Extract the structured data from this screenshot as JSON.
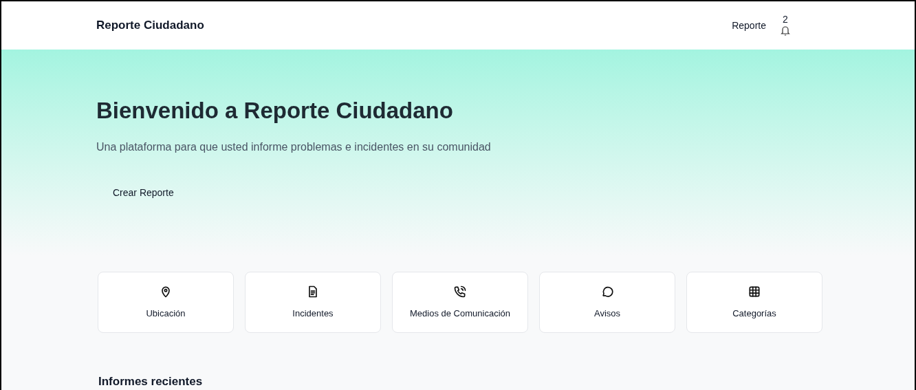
{
  "header": {
    "brand": "Reporte Ciudadano",
    "nav_link": "Reporte",
    "notification_count": "2"
  },
  "hero": {
    "title": "Bienvenido a Reporte Ciudadano",
    "subtitle": "Una plataforma para que usted informe problemas e incidentes en su comunidad",
    "button": "Crear Reporte"
  },
  "cards": [
    {
      "kind": "pin",
      "label": "Ubicación"
    },
    {
      "kind": "document",
      "label": "Incidentes"
    },
    {
      "kind": "phone",
      "label": "Medios de Comunicación"
    },
    {
      "kind": "chat",
      "label": "Avisos"
    },
    {
      "kind": "grid",
      "label": "Categorías"
    }
  ],
  "recent": {
    "title": "Informes recientes"
  }
}
